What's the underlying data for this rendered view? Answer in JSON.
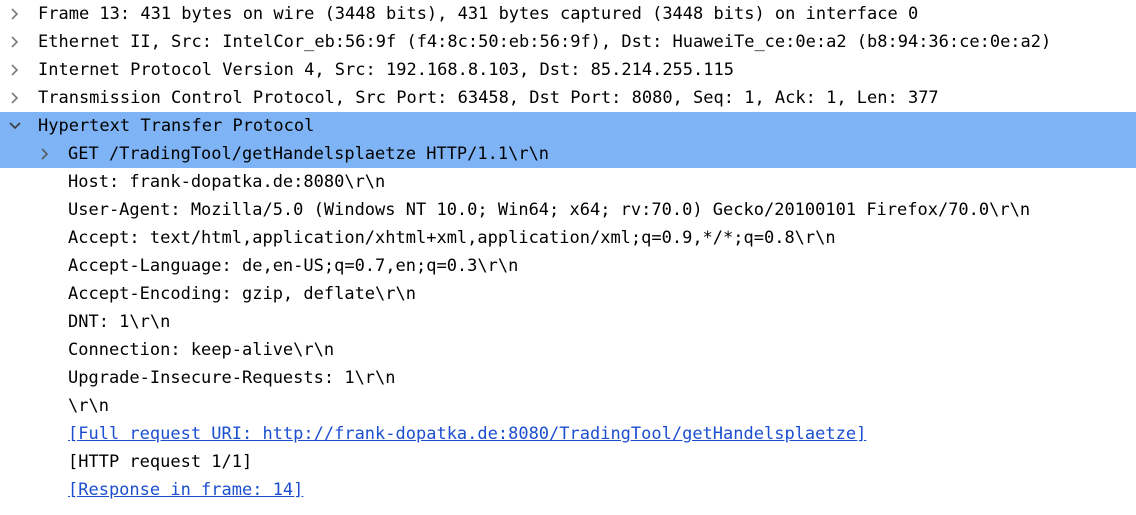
{
  "colors": {
    "selection": "#7eb4f5",
    "link": "#1b4fd0",
    "expander": "#7a7a7a"
  },
  "tree": {
    "frame": {
      "label": "Frame 13: 431 bytes on wire (3448 bits), 431 bytes captured (3448 bits) on interface 0",
      "icon": "chevron-right-icon"
    },
    "ethernet": {
      "label": "Ethernet II, Src: IntelCor_eb:56:9f (f4:8c:50:eb:56:9f), Dst: HuaweiTe_ce:0e:a2 (b8:94:36:ce:0e:a2)",
      "icon": "chevron-right-icon"
    },
    "ip": {
      "label": "Internet Protocol Version 4, Src: 192.168.8.103, Dst: 85.214.255.115",
      "icon": "chevron-right-icon"
    },
    "tcp": {
      "label": "Transmission Control Protocol, Src Port: 63458, Dst Port: 8080, Seq: 1, Ack: 1, Len: 377",
      "icon": "chevron-right-icon"
    },
    "http": {
      "label": "Hypertext Transfer Protocol",
      "icon": "chevron-down-icon",
      "children": {
        "request_line": {
          "label": "GET /TradingTool/getHandelsplaetze HTTP/1.1\\r\\n",
          "icon": "chevron-right-icon"
        },
        "host": "Host: frank-dopatka.de:8080\\r\\n",
        "user_agent": "User-Agent: Mozilla/5.0 (Windows NT 10.0; Win64; x64; rv:70.0) Gecko/20100101 Firefox/70.0\\r\\n",
        "accept": "Accept: text/html,application/xhtml+xml,application/xml;q=0.9,*/*;q=0.8\\r\\n",
        "accept_language": "Accept-Language: de,en-US;q=0.7,en;q=0.3\\r\\n",
        "accept_encoding": "Accept-Encoding: gzip, deflate\\r\\n",
        "dnt": "DNT: 1\\r\\n",
        "connection": "Connection: keep-alive\\r\\n",
        "upgrade": "Upgrade-Insecure-Requests: 1\\r\\n",
        "crlf": "\\r\\n",
        "full_uri": "[Full request URI: http://frank-dopatka.de:8080/TradingTool/getHandelsplaetze]",
        "request_count": "[HTTP request 1/1]",
        "response_in": "[Response in frame: 14]"
      }
    }
  }
}
